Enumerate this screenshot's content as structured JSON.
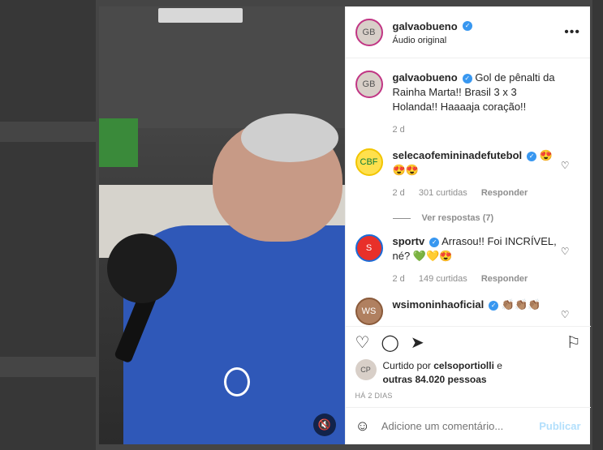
{
  "post": {
    "username": "galvaobueno",
    "audio_label": "Áudio original",
    "more_icon": "•••",
    "caption": "Gol de pênalti da Rainha Marta!! Brasil 3 x 3 Holanda!! Haaaaja coração!!",
    "caption_age": "2 d"
  },
  "comments": [
    {
      "username": "selecaofemininadefutebol",
      "text": "😍 😍😍",
      "age": "2 d",
      "likes": "301 curtidas",
      "reply": "Responder",
      "view_replies": "Ver respostas (7)"
    },
    {
      "username": "sportv",
      "text": "Arrasou!! Foi INCRÍVEL, né? 💚💛😍",
      "age": "2 d",
      "likes": "149 curtidas",
      "reply": "Responder"
    },
    {
      "username": "wsimoninhaoficial",
      "text": "👏🏽👏🏽👏🏽"
    }
  ],
  "likes": {
    "prefix": "Curtido por",
    "user": "celsoportiolli",
    "suffix": "e",
    "others": "outras 84.020 pessoas"
  },
  "time_ago": "HÁ 2 DIAS",
  "add_comment": {
    "placeholder": "Adicione um comentário...",
    "post_label": "Publicar"
  },
  "icons": {
    "heart": "♡",
    "comment": "◯",
    "share": "➤",
    "save": "⚐",
    "emoji": "☺",
    "mute": "🔇"
  },
  "colors": {
    "verified": "#3897f0",
    "publish": "#b2dffc",
    "shirt": "#2f58b8"
  }
}
